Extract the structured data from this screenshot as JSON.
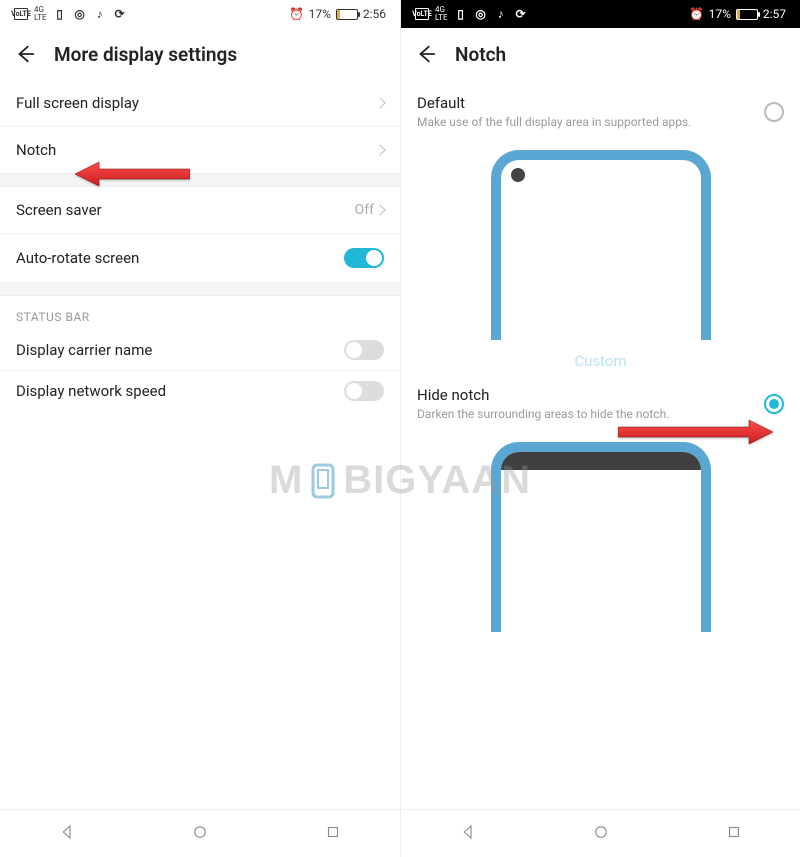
{
  "left": {
    "status": {
      "battery_text": "17%",
      "time": "2:56"
    },
    "app_title": "More display settings",
    "rows": {
      "full_screen": "Full screen display",
      "notch": "Notch",
      "screen_saver": "Screen saver",
      "screen_saver_value": "Off",
      "auto_rotate": "Auto-rotate screen"
    },
    "section_title": "STATUS BAR",
    "status_rows": {
      "carrier": "Display carrier name",
      "netspeed": "Display network speed"
    }
  },
  "right": {
    "status": {
      "battery_text": "17%",
      "time": "2:57"
    },
    "app_title": "Notch",
    "default_title": "Default",
    "default_sub": "Make use of the full display area in supported apps.",
    "custom_label": "Custom",
    "hide_title": "Hide notch",
    "hide_sub": "Darken the surrounding areas to hide the notch."
  },
  "watermark": {
    "pre": "M",
    "mid": "BIGYAAN"
  }
}
